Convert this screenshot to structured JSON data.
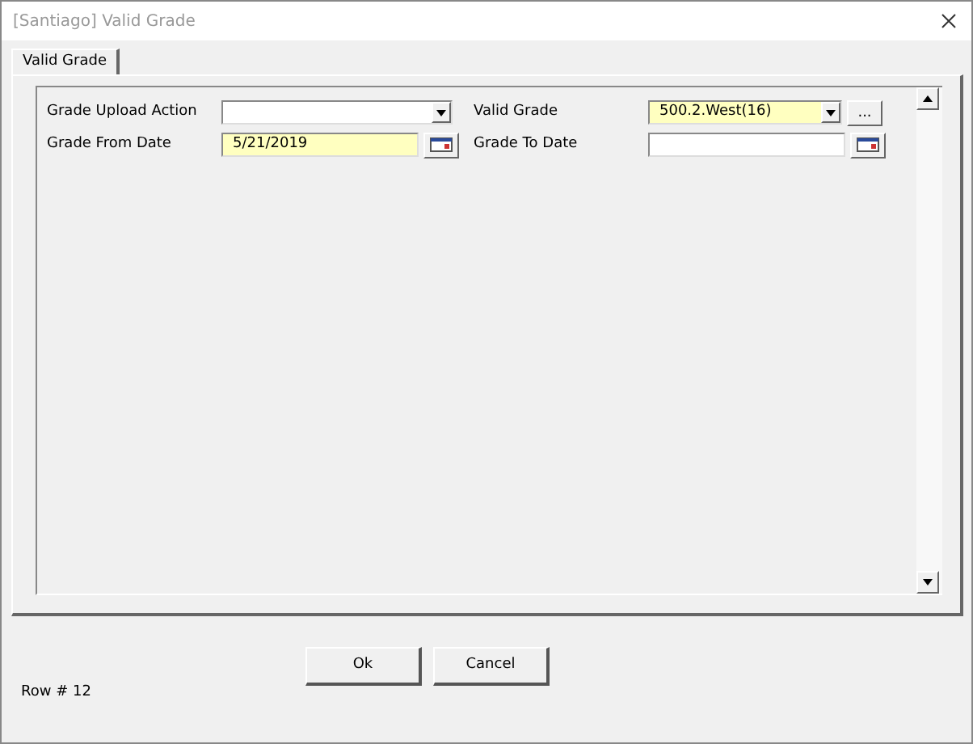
{
  "window": {
    "title": "[Santiago] Valid Grade"
  },
  "tabs": [
    {
      "label": "Valid Grade",
      "selected": true
    }
  ],
  "fields": [
    {
      "label": "Grade Upload Action",
      "kind": "dropdown",
      "highlighted": false
    },
    {
      "label": "Valid Grade",
      "kind": "dropdown",
      "value": "500.2.West(16)",
      "highlighted": true,
      "extra_button": "..."
    },
    {
      "label": "Grade From Date",
      "kind": "date",
      "value": "5/21/2019",
      "highlighted": true
    },
    {
      "label": "Grade To Date",
      "kind": "date",
      "highlighted": false
    }
  ],
  "row_label": "Row # 12",
  "buttons": [
    "Ok",
    "Cancel"
  ]
}
